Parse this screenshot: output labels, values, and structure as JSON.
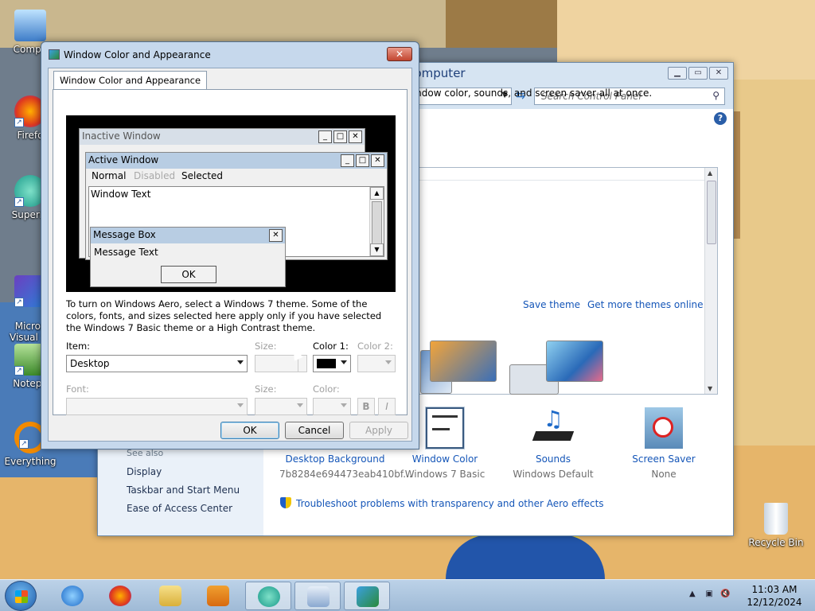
{
  "desktop": {
    "icons": [
      {
        "label": "Compu",
        "icon": "computer-icon"
      },
      {
        "label": "Firefo",
        "icon": "firefox-icon"
      },
      {
        "label": "Superm",
        "icon": "supermium-icon"
      },
      {
        "label": "Micros\nVisual St",
        "icon": "visual-studio-icon"
      },
      {
        "label": "Notepa",
        "icon": "notepad-icon"
      },
      {
        "label": "Everything",
        "icon": "everything-icon"
      },
      {
        "label": "Recycle Bin",
        "icon": "recycle-bin-icon"
      }
    ]
  },
  "control_panel": {
    "search_placeholder": "Search Control Panel",
    "heading": "ounds on your computer",
    "subtitle": "ktop background, window color, sounds, and screen saver all at once.",
    "links": {
      "save_theme": "Save theme",
      "get_more": "Get more themes online"
    },
    "see_also": "See also",
    "nav": [
      "Display",
      "Taskbar and Start Menu",
      "Ease of Access Center"
    ],
    "items": [
      {
        "title": "Desktop Background",
        "value": "7b8284e694473eab410bf...",
        "icon": "desktop-background-icon"
      },
      {
        "title": "Window Color",
        "value": "Windows 7 Basic",
        "icon": "window-color-icon"
      },
      {
        "title": "Sounds",
        "value": "Windows Default",
        "icon": "sounds-icon"
      },
      {
        "title": "Screen Saver",
        "value": "None",
        "icon": "screen-saver-icon"
      }
    ],
    "troubleshoot": "Troubleshoot problems with transparency and other Aero effects"
  },
  "dialog": {
    "title": "Window Color and Appearance",
    "tab": "Window Color and Appearance",
    "preview": {
      "inactive_title": "Inactive Window",
      "active_title": "Active Window",
      "menu": {
        "normal": "Normal",
        "disabled": "Disabled",
        "selected": "Selected"
      },
      "window_text": "Window Text",
      "msgbox_title": "Message Box",
      "msgbox_text": "Message Text",
      "msgbox_ok": "OK"
    },
    "info": "To turn on Windows Aero, select a Windows 7 theme.  Some of the colors, fonts, and sizes selected here apply only if you have selected the Windows 7 Basic theme or a High Contrast theme.",
    "labels": {
      "item": "Item:",
      "size": "Size:",
      "color1": "Color 1:",
      "color2": "Color 2:",
      "font": "Font:",
      "size2": "Size:",
      "color": "Color:"
    },
    "item_value": "Desktop",
    "color1_value": "#000000",
    "bold": "B",
    "italic": "I",
    "buttons": {
      "ok": "OK",
      "cancel": "Cancel",
      "apply": "Apply"
    }
  },
  "taskbar": {
    "apps": [
      "ie-icon",
      "firefox-icon",
      "explorer-icon",
      "media-player-icon",
      "supermium-icon",
      "control-panel-icon",
      "personalization-icon"
    ],
    "time": "11:03 AM",
    "date": "12/12/2024"
  }
}
